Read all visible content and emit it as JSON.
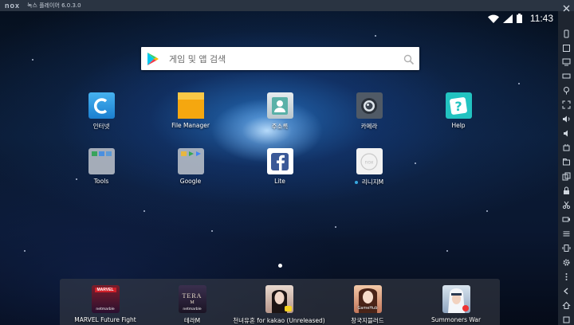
{
  "window": {
    "logo": "nox",
    "title": "녹스 플레이어 6.0.3.0"
  },
  "statusbar": {
    "time": "11:43"
  },
  "search": {
    "placeholder": "게임 및 앱 검색"
  },
  "apps": [
    {
      "label": "인터넷",
      "icon": "browser-icon"
    },
    {
      "label": "File Manager",
      "icon": "folder-icon"
    },
    {
      "label": "주소록",
      "icon": "contacts-icon"
    },
    {
      "label": "카메라",
      "icon": "camera-icon"
    },
    {
      "label": "Help",
      "icon": "help-icon"
    },
    {
      "label": "Tools",
      "icon": "tools-folder-icon"
    },
    {
      "label": "Google",
      "icon": "google-folder-icon"
    },
    {
      "label": "Lite",
      "icon": "facebook-lite-icon"
    },
    {
      "label": "리니지M",
      "icon": "lineage-m-icon"
    }
  ],
  "dock": [
    {
      "label": "MARVEL Future Fight",
      "icon_text": "MARVEL",
      "icon_sub": "netmarble"
    },
    {
      "label": "테라M",
      "icon_text": "TERA",
      "icon_sub": "netmarble"
    },
    {
      "label": "천녀유혼 for kakao (Unreleased)",
      "icon_text": "",
      "icon_sub": ""
    },
    {
      "label": "창국지블러드",
      "icon_text": "",
      "icon_sub": "GameHub"
    },
    {
      "label": "Summoners War",
      "icon_text": "",
      "icon_sub": ""
    }
  ],
  "colors": {
    "titlebar": "#2a3442",
    "toolbar": "#1e2530",
    "accent_blue": "#38a8e0"
  }
}
